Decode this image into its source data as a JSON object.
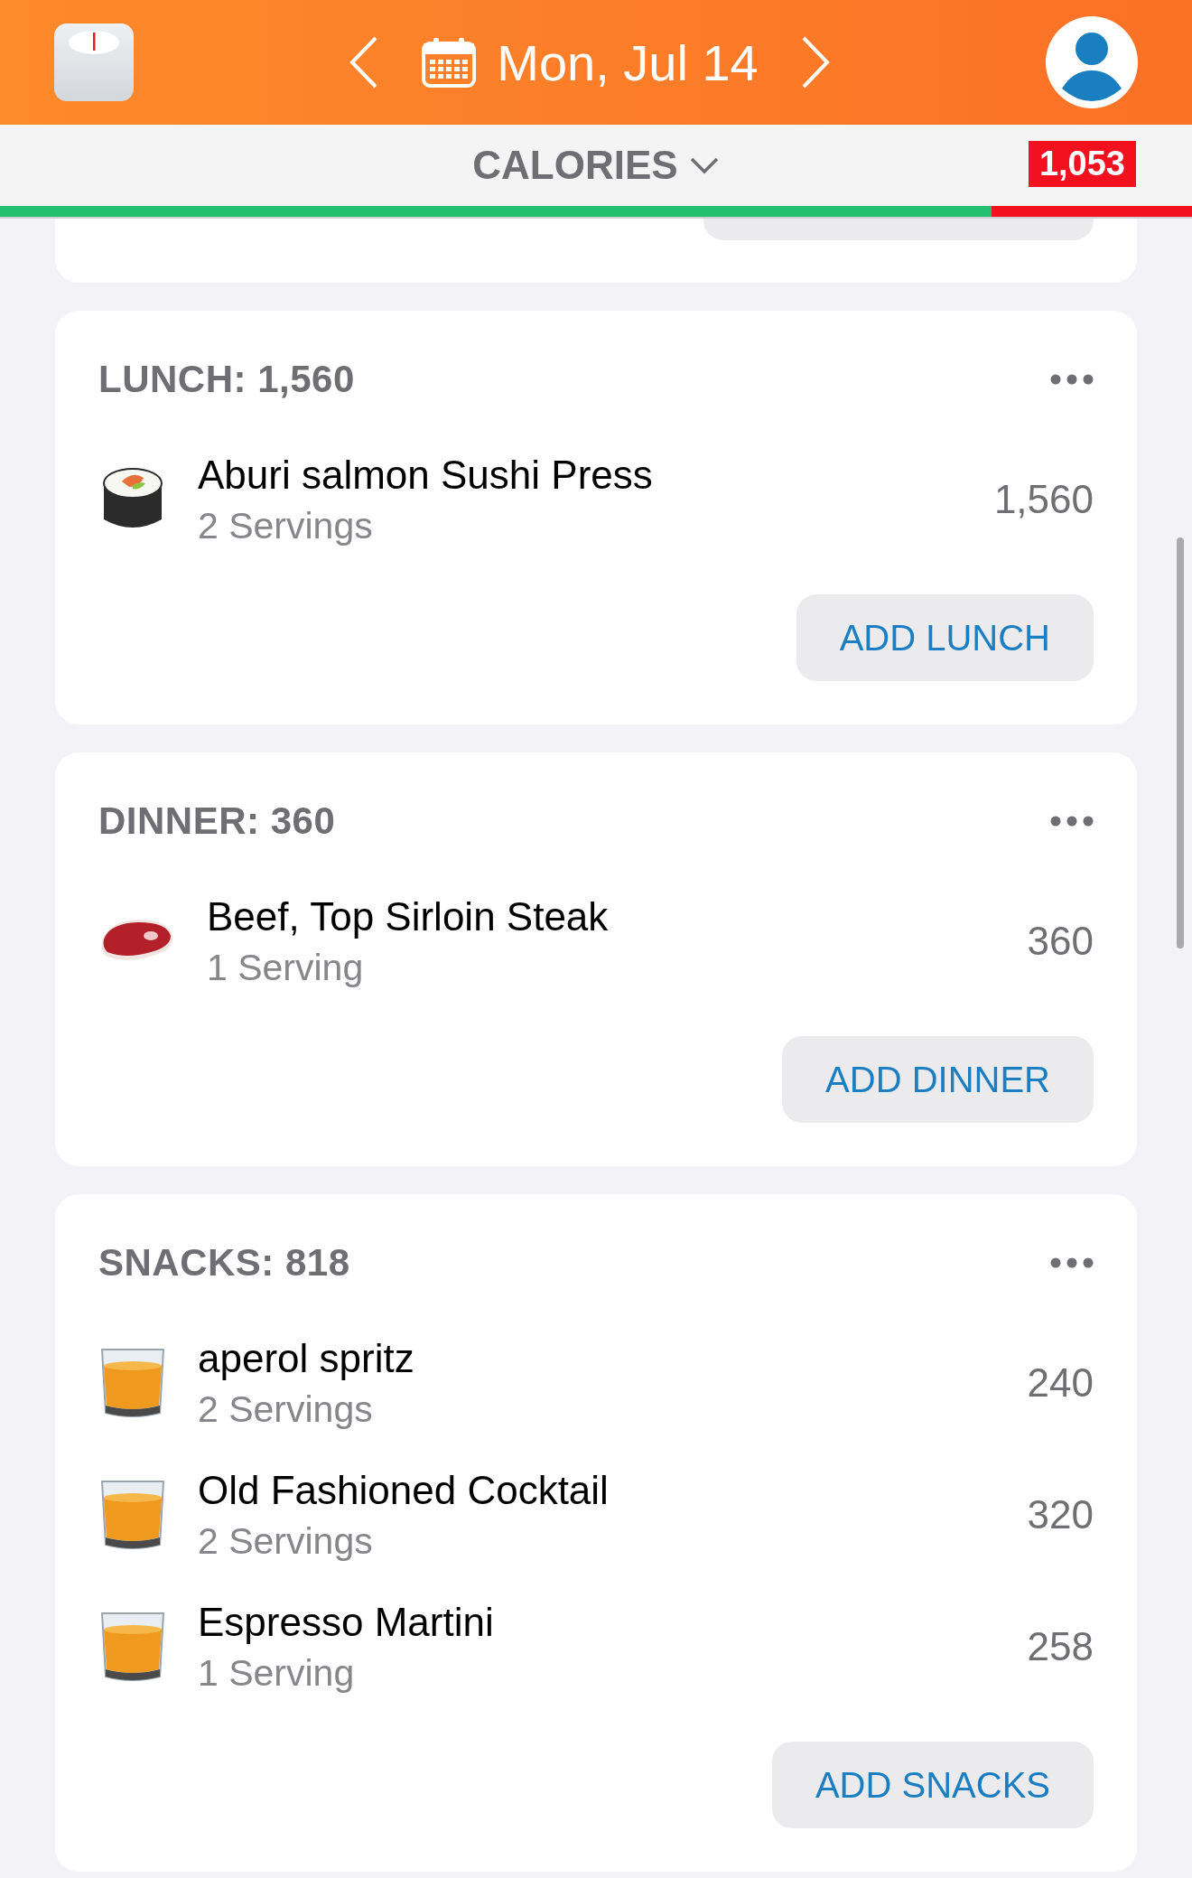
{
  "header": {
    "date": "Mon, Jul 14"
  },
  "metric": {
    "label": "CALORIES",
    "remaining": "1,053",
    "level": 0.832
  },
  "meals": [
    {
      "title": "LUNCH: 1,560",
      "button": "ADD LUNCH",
      "items": [
        {
          "kind": "sushi",
          "name": "Aburi salmon Sushi Press",
          "servings": "2 Servings",
          "calories": "1,560"
        }
      ]
    },
    {
      "title": "DINNER: 360",
      "button": "ADD DINNER",
      "items": [
        {
          "kind": "steak",
          "name": "Beef, Top Sirloin Steak",
          "servings": "1 Serving",
          "calories": "360"
        }
      ]
    },
    {
      "title": "SNACKS: 818",
      "button": "ADD SNACKS",
      "items": [
        {
          "kind": "glass",
          "name": "aperol spritz",
          "servings": "2 Servings",
          "calories": "240"
        },
        {
          "kind": "glass",
          "name": "Old Fashioned Cocktail",
          "servings": "2 Servings",
          "calories": "320"
        },
        {
          "kind": "glass",
          "name": "Espresso Martini",
          "servings": "1 Serving",
          "calories": "258"
        }
      ]
    }
  ]
}
